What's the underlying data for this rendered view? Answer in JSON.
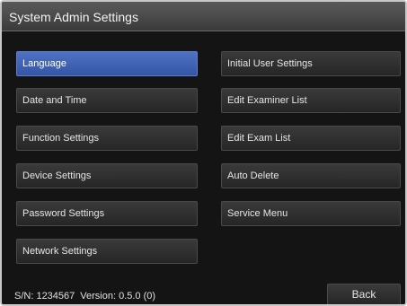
{
  "window": {
    "title": "System Admin Settings"
  },
  "left_menu": {
    "items": [
      {
        "label": "Language",
        "selected": true
      },
      {
        "label": "Date and Time",
        "selected": false
      },
      {
        "label": "Function Settings",
        "selected": false
      },
      {
        "label": "Device Settings",
        "selected": false
      },
      {
        "label": "Password Settings",
        "selected": false
      },
      {
        "label": "Network Settings",
        "selected": false
      }
    ]
  },
  "right_menu": {
    "items": [
      {
        "label": "Initial User Settings"
      },
      {
        "label": "Edit Examiner List"
      },
      {
        "label": "Edit Exam List"
      },
      {
        "label": "Auto Delete"
      },
      {
        "label": "Service Menu"
      }
    ]
  },
  "footer": {
    "serial": "S/N: 1234567",
    "version": "Version: 0.5.0 (0)",
    "back_label": "Back"
  },
  "colors": {
    "selected_accent": "#3f63b8",
    "background": "#141414",
    "titlebar": "#4a4a4a"
  }
}
